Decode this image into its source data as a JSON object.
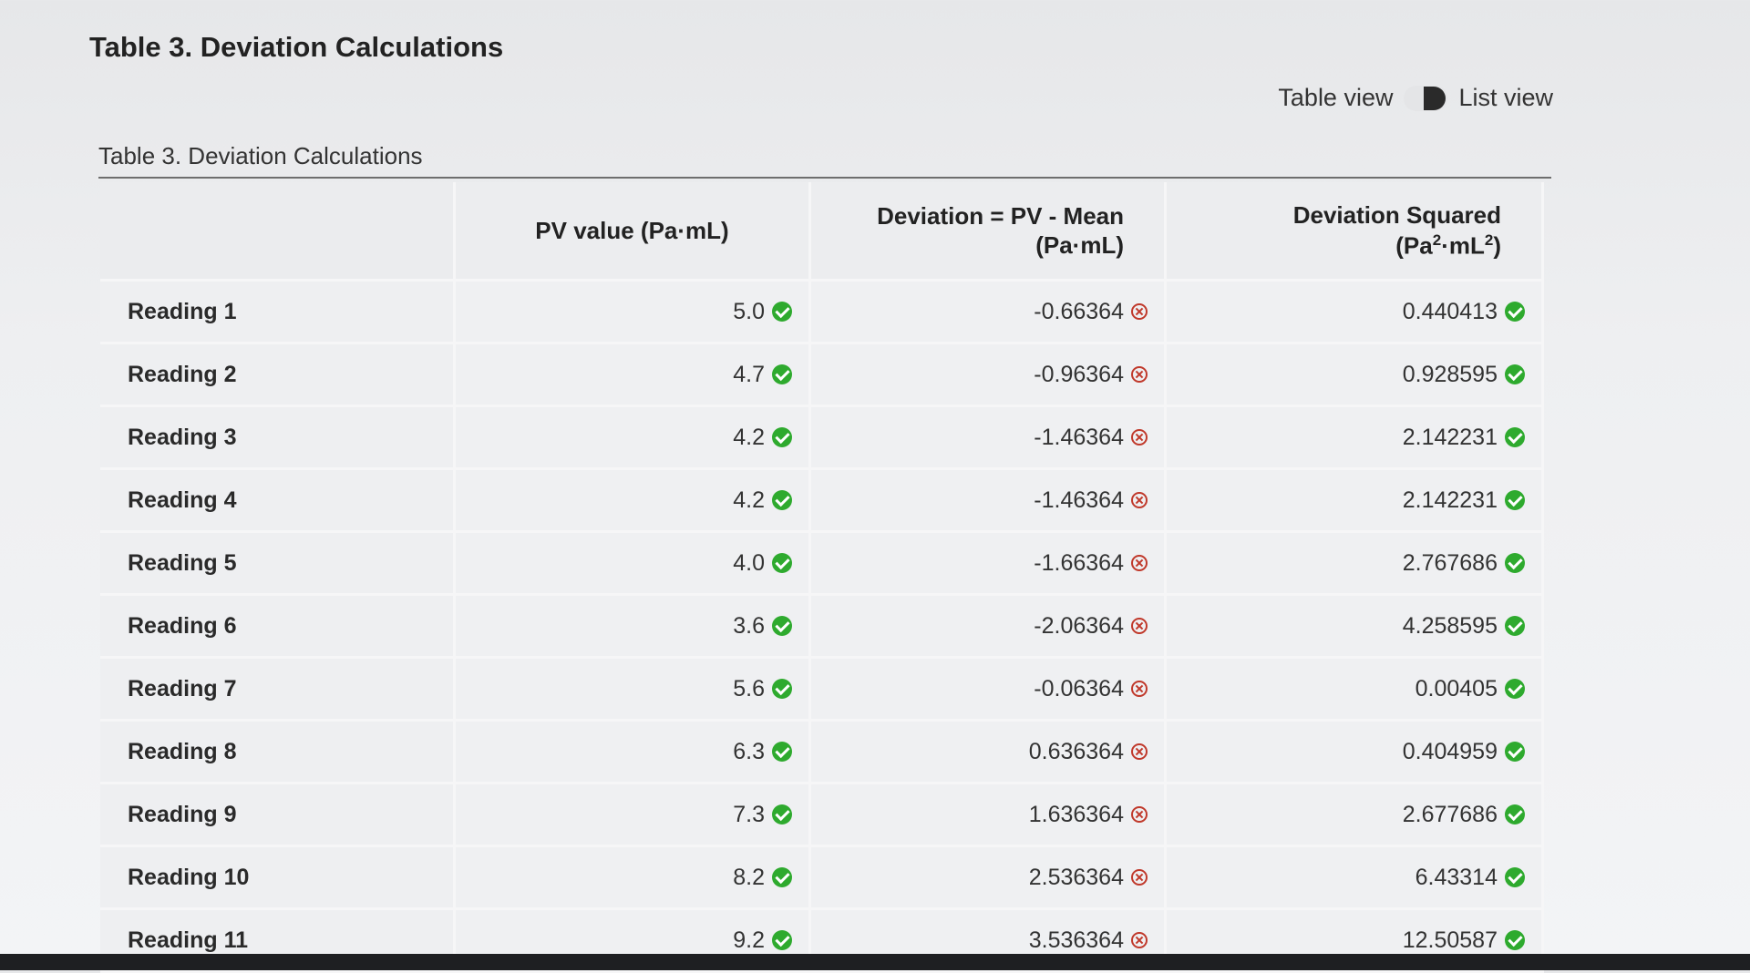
{
  "page": {
    "title": "Table 3. Deviation Calculations"
  },
  "view_toggle": {
    "table_label": "Table view",
    "list_label": "List view",
    "selected": "List view"
  },
  "table": {
    "caption": "Table 3. Deviation Calculations",
    "headers": {
      "row_label": "",
      "pv": "PV value (Pa·mL)",
      "deviation_line1": "Deviation = PV - Mean",
      "deviation_line2": "(Pa·mL)",
      "squared_line1": "Deviation Squared",
      "squared_line2_pre": "(Pa",
      "squared_exp1": "2",
      "squared_line2_mid": "·mL",
      "squared_exp2": "2",
      "squared_line2_post": ")"
    },
    "rows": [
      {
        "label": "Reading 1",
        "pv": "5.0",
        "deviation": "-0.66364",
        "squared": "0.440413"
      },
      {
        "label": "Reading 2",
        "pv": "4.7",
        "deviation": "-0.96364",
        "squared": "0.928595"
      },
      {
        "label": "Reading 3",
        "pv": "4.2",
        "deviation": "-1.46364",
        "squared": "2.142231"
      },
      {
        "label": "Reading 4",
        "pv": "4.2",
        "deviation": "-1.46364",
        "squared": "2.142231"
      },
      {
        "label": "Reading 5",
        "pv": "4.0",
        "deviation": "-1.66364",
        "squared": "2.767686"
      },
      {
        "label": "Reading 6",
        "pv": "3.6",
        "deviation": "-2.06364",
        "squared": "4.258595"
      },
      {
        "label": "Reading 7",
        "pv": "5.6",
        "deviation": "-0.06364",
        "squared": "0.00405"
      },
      {
        "label": "Reading 8",
        "pv": "6.3",
        "deviation": "0.636364",
        "squared": "0.404959"
      },
      {
        "label": "Reading 9",
        "pv": "7.3",
        "deviation": "1.636364",
        "squared": "2.677686"
      },
      {
        "label": "Reading 10",
        "pv": "8.2",
        "deviation": "2.536364",
        "squared": "6.43314"
      },
      {
        "label": "Reading 11",
        "pv": "9.2",
        "deviation": "3.536364",
        "squared": "12.50587"
      }
    ],
    "status_icons": {
      "pv": "check-circle-icon",
      "deviation": "x-circle-icon",
      "squared": "check-circle-icon"
    },
    "colors": {
      "correct": "#2eaa2e",
      "incorrect": "#c0392b"
    }
  }
}
